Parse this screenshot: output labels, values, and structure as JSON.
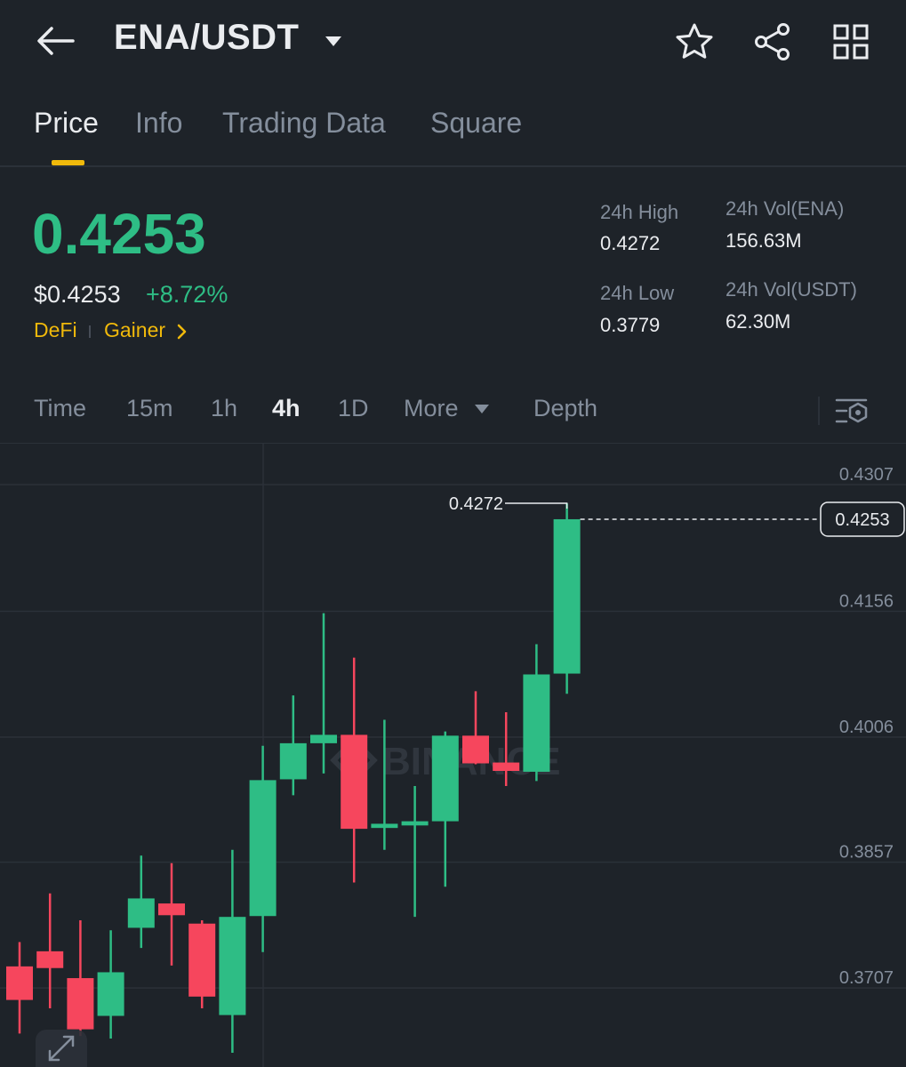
{
  "header": {
    "pair": "ENA/USDT",
    "icons": [
      "back-arrow-icon",
      "caret-down-icon",
      "star-icon",
      "share-icon",
      "grid-icon"
    ]
  },
  "tabs": [
    {
      "label": "Price",
      "active": true
    },
    {
      "label": "Info",
      "active": false
    },
    {
      "label": "Trading Data",
      "active": false
    },
    {
      "label": "Square",
      "active": false
    }
  ],
  "price": {
    "last": "0.4253",
    "usd": "$0.4253",
    "change": "+8.72%",
    "tags": [
      "DeFi",
      "Gainer"
    ]
  },
  "stats": {
    "high_label": "24h High",
    "high_value": "0.4272",
    "low_label": "24h Low",
    "low_value": "0.3779",
    "vol_base_label": "24h Vol(ENA)",
    "vol_base_value": "156.63M",
    "vol_quote_label": "24h Vol(USDT)",
    "vol_quote_value": "62.30M"
  },
  "intervals": [
    {
      "label": "Time",
      "active": false
    },
    {
      "label": "15m",
      "active": false
    },
    {
      "label": "1h",
      "active": false
    },
    {
      "label": "4h",
      "active": true
    },
    {
      "label": "1D",
      "active": false
    },
    {
      "label": "More",
      "active": false
    },
    {
      "label": "Depth",
      "active": false
    }
  ],
  "colors": {
    "up": "#2ebd85",
    "down": "#f6465d",
    "accent": "#f0b90b",
    "background": "#1e2329"
  },
  "chart_data": {
    "type": "candlestick",
    "interval": "4h",
    "y_ticks": [
      "0.4307",
      "0.4156",
      "0.4006",
      "0.3857",
      "0.3707"
    ],
    "ylim": [
      0.3617,
      0.436
    ],
    "last_price_label": "0.4253",
    "high_marker_label": "0.4272",
    "watermark": "BINANCE",
    "candles": [
      {
        "o": 0.372,
        "h": 0.3749,
        "l": 0.364,
        "c": 0.368
      },
      {
        "o": 0.3738,
        "h": 0.3807,
        "l": 0.367,
        "c": 0.3718
      },
      {
        "o": 0.3706,
        "h": 0.3775,
        "l": 0.3637,
        "c": 0.3645
      },
      {
        "o": 0.3661,
        "h": 0.3763,
        "l": 0.3634,
        "c": 0.3713
      },
      {
        "o": 0.3766,
        "h": 0.3852,
        "l": 0.3742,
        "c": 0.3801
      },
      {
        "o": 0.3795,
        "h": 0.3843,
        "l": 0.3721,
        "c": 0.3781
      },
      {
        "o": 0.3771,
        "h": 0.3775,
        "l": 0.367,
        "c": 0.3684
      },
      {
        "o": 0.3662,
        "h": 0.3859,
        "l": 0.3617,
        "c": 0.3779
      },
      {
        "o": 0.378,
        "h": 0.3983,
        "l": 0.3737,
        "c": 0.3942
      },
      {
        "o": 0.3943,
        "h": 0.4043,
        "l": 0.3924,
        "c": 0.3986
      },
      {
        "o": 0.3986,
        "h": 0.4141,
        "l": 0.395,
        "c": 0.3996
      },
      {
        "o": 0.3996,
        "h": 0.4088,
        "l": 0.382,
        "c": 0.3884
      },
      {
        "o": 0.3885,
        "h": 0.4014,
        "l": 0.3859,
        "c": 0.389
      },
      {
        "o": 0.3888,
        "h": 0.3935,
        "l": 0.3779,
        "c": 0.3893
      },
      {
        "o": 0.3893,
        "h": 0.4,
        "l": 0.3815,
        "c": 0.3995
      },
      {
        "o": 0.3995,
        "h": 0.4048,
        "l": 0.3961,
        "c": 0.3962
      },
      {
        "o": 0.3963,
        "h": 0.4023,
        "l": 0.3935,
        "c": 0.3953
      },
      {
        "o": 0.3952,
        "h": 0.4104,
        "l": 0.3941,
        "c": 0.4068
      },
      {
        "o": 0.4069,
        "h": 0.4272,
        "l": 0.4045,
        "c": 0.4253
      }
    ]
  }
}
